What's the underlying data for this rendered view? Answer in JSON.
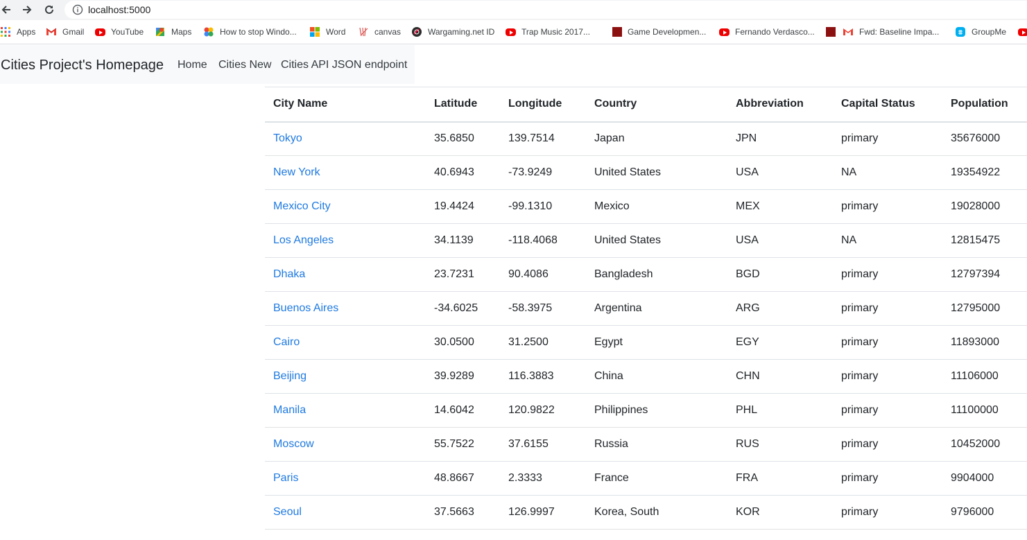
{
  "browser": {
    "url": "localhost:5000",
    "bookmarks": [
      {
        "label": "Apps",
        "icon": "apps-grid-icon"
      },
      {
        "label": "Gmail",
        "icon": "gmail-icon"
      },
      {
        "label": "YouTube",
        "icon": "youtube-icon"
      },
      {
        "label": "Maps",
        "icon": "maps-icon"
      },
      {
        "label": "How to stop Windo...",
        "icon": "pinwheel-icon"
      },
      {
        "label": "Word",
        "icon": "microsoft-icon"
      },
      {
        "label": "canvas",
        "icon": "canvas-icon"
      },
      {
        "label": "Wargaming.net ID",
        "icon": "wargaming-icon"
      },
      {
        "label": "Trap Music 2017...",
        "icon": "youtube-icon"
      },
      {
        "label": "Game Developmen...",
        "icon": "red-square-icon"
      },
      {
        "label": "Fernando Verdasco...",
        "icon": "youtube-icon"
      },
      {
        "label": "Fwd: Baseline Impa...",
        "icon": "gmail-icon"
      },
      {
        "label": "GroupMe",
        "icon": "groupme-icon"
      }
    ]
  },
  "navbar": {
    "brand": "Cities Project's Homepage",
    "links": [
      "Home",
      "Cities New",
      "Cities API JSON endpoint"
    ]
  },
  "table": {
    "headers": [
      "City Name",
      "Latitude",
      "Longitude",
      "Country",
      "Abbreviation",
      "Capital Status",
      "Population"
    ],
    "rows": [
      [
        "Tokyo",
        "35.6850",
        "139.7514",
        "Japan",
        "JPN",
        "primary",
        "35676000"
      ],
      [
        "New York",
        "40.6943",
        "-73.9249",
        "United States",
        "USA",
        "NA",
        "19354922"
      ],
      [
        "Mexico City",
        "19.4424",
        "-99.1310",
        "Mexico",
        "MEX",
        "primary",
        "19028000"
      ],
      [
        "Los Angeles",
        "34.1139",
        "-118.4068",
        "United States",
        "USA",
        "NA",
        "12815475"
      ],
      [
        "Dhaka",
        "23.7231",
        "90.4086",
        "Bangladesh",
        "BGD",
        "primary",
        "12797394"
      ],
      [
        "Buenos Aires",
        "-34.6025",
        "-58.3975",
        "Argentina",
        "ARG",
        "primary",
        "12795000"
      ],
      [
        "Cairo",
        "30.0500",
        "31.2500",
        "Egypt",
        "EGY",
        "primary",
        "11893000"
      ],
      [
        "Beijing",
        "39.9289",
        "116.3883",
        "China",
        "CHN",
        "primary",
        "11106000"
      ],
      [
        "Manila",
        "14.6042",
        "120.9822",
        "Philippines",
        "PHL",
        "primary",
        "11100000"
      ],
      [
        "Moscow",
        "55.7522",
        "37.6155",
        "Russia",
        "RUS",
        "primary",
        "10452000"
      ],
      [
        "Paris",
        "48.8667",
        "2.3333",
        "France",
        "FRA",
        "primary",
        "9904000"
      ],
      [
        "Seoul",
        "37.5663",
        "126.9997",
        "Korea, South",
        "KOR",
        "primary",
        "9796000"
      ]
    ]
  }
}
